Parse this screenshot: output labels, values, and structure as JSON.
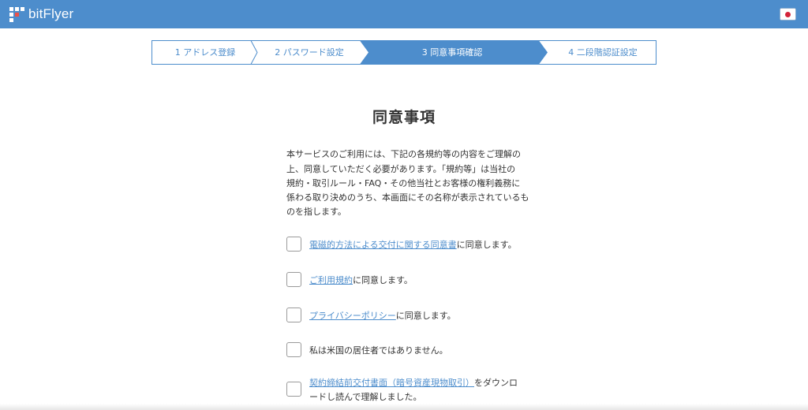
{
  "header": {
    "brand": "bitFlyer",
    "language_flag": "japan-flag-icon",
    "color": "#4d8dcc"
  },
  "steps": [
    {
      "label": "1 アドレス登録",
      "state": "done"
    },
    {
      "label": "2 パスワード設定",
      "state": "done"
    },
    {
      "label": "3 同意事項確認",
      "state": "active"
    },
    {
      "label": "4 二段階認証設定",
      "state": "pending"
    }
  ],
  "main": {
    "title": "同意事項",
    "intro_lines": [
      "本サービスのご利用には、下記の各規約等の内容をご理解の",
      "上、同意していただく必要があります。「規約等」は当社の",
      "規約・取引ルール・FAQ・その他当社とお客様の権利義務に",
      "係わる取り決めのうち、本画面にその名称が表示されているも",
      "のを指します。"
    ],
    "agreements": [
      {
        "link": "電磁的方法による交付に関する同意書",
        "text": "に同意します。",
        "checked": false
      },
      {
        "link": "ご利用規約",
        "text": "に同意します。",
        "checked": false
      },
      {
        "link": "プライバシーポリシー",
        "text": "に同意します。",
        "checked": false
      },
      {
        "link": "",
        "text": "私は米国の居住者ではありません。",
        "checked": false
      },
      {
        "link": "契約締結前交付書面（暗号資産現物取引）",
        "text": "をダウンロ",
        "text_line2": "ードし読んで理解しました。",
        "checked": false
      }
    ]
  }
}
